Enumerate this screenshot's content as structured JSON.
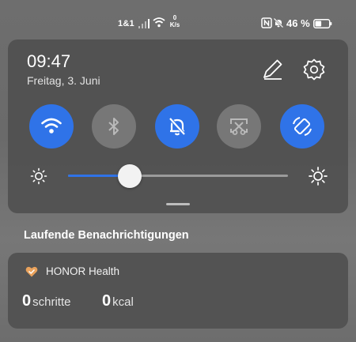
{
  "status_bar": {
    "carrier": "1&1",
    "net_speed_value": "0",
    "net_speed_unit": "K/s",
    "battery_percent": "46 %",
    "battery_level": 0.46,
    "icons": [
      "signal-icon",
      "wifi-icon",
      "nfc-icon",
      "mute-icon",
      "battery-icon"
    ]
  },
  "quick_settings": {
    "time": "09:47",
    "date": "Freitag, 3. Juni",
    "accent_color": "#2f73e8",
    "toggles": [
      {
        "name": "wifi",
        "icon": "wifi-icon",
        "state": "on"
      },
      {
        "name": "bluetooth",
        "icon": "bluetooth-icon",
        "state": "off"
      },
      {
        "name": "do-not-disturb",
        "icon": "bell-off-icon",
        "state": "on"
      },
      {
        "name": "screenshot",
        "icon": "screenshot-scissors-icon",
        "state": "off"
      },
      {
        "name": "auto-rotate",
        "icon": "auto-rotate-icon",
        "state": "on"
      }
    ],
    "brightness_level": 0.28
  },
  "notifications": {
    "section_title": "Laufende Benachrichtigungen",
    "items": [
      {
        "app_name": "HONOR Health",
        "app_icon": "heart-icon",
        "app_color": "#e9a25c",
        "steps_value": "0",
        "steps_unit": "schritte",
        "kcal_value": "0",
        "kcal_unit": "kcal"
      }
    ]
  }
}
